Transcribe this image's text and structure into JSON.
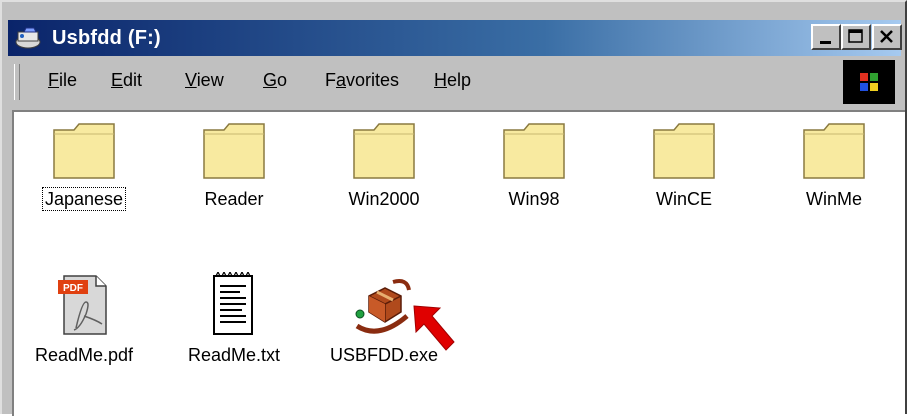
{
  "window": {
    "title": "Usbfdd (F:)"
  },
  "menu": {
    "file": {
      "accel": "F",
      "rest": "ile"
    },
    "edit": {
      "accel": "E",
      "rest": "dit"
    },
    "view": {
      "accel": "V",
      "rest": "iew"
    },
    "go": {
      "accel": "G",
      "rest": "o"
    },
    "favorites": {
      "pre": "F",
      "accel": "a",
      "rest": "vorites"
    },
    "help": {
      "accel": "H",
      "rest": "elp"
    }
  },
  "folders": [
    {
      "label": "Japanese",
      "icon": "folder-icon"
    },
    {
      "label": "Reader",
      "icon": "folder-icon"
    },
    {
      "label": "Win2000",
      "icon": "folder-icon"
    },
    {
      "label": "Win98",
      "icon": "folder-icon"
    },
    {
      "label": "WinCE",
      "icon": "folder-icon"
    },
    {
      "label": "WinMe",
      "icon": "folder-icon"
    }
  ],
  "files": [
    {
      "label": "ReadMe.pdf",
      "icon": "pdf-file-icon",
      "badge": "PDF"
    },
    {
      "label": "ReadMe.txt",
      "icon": "text-file-icon"
    },
    {
      "label": "USBFDD.exe",
      "icon": "installer-package-icon"
    }
  ],
  "colors": {
    "titlebar_start": "#0a246a",
    "titlebar_end": "#a6caf0",
    "window_face": "#c0c0c0",
    "folder_fill": "#f8eaa0",
    "pointer_arrow": "#e00000"
  }
}
